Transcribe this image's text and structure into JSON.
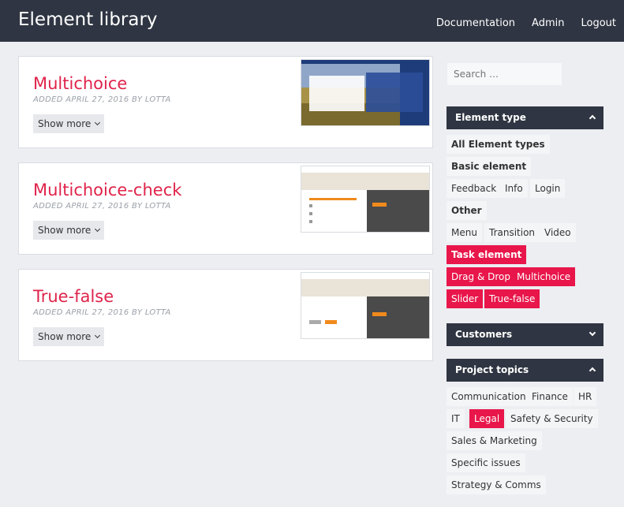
{
  "header": {
    "title": "Element library",
    "nav": [
      "Documentation",
      "Admin",
      "Logout"
    ]
  },
  "cards": [
    {
      "title": "Multichoice",
      "meta": "ADDED APRIL 27, 2016 BY LOTTA",
      "button": "Show more"
    },
    {
      "title": "Multichoice-check",
      "meta": "ADDED APRIL 27, 2016 BY LOTTA",
      "button": "Show more"
    },
    {
      "title": "True-false",
      "meta": "ADDED APRIL 27, 2016 BY LOTTA",
      "button": "Show more"
    }
  ],
  "sidebar": {
    "search_placeholder": "Search …",
    "element_type": {
      "title": "Element type",
      "tags": [
        "All Element types",
        "Basic element",
        "Feedback",
        "Info",
        "Login",
        "Other",
        "Menu",
        "Transition",
        "Video",
        "Task element",
        "Drag & Drop",
        "Multichoice",
        "Slider",
        "True-false"
      ]
    },
    "customers": {
      "title": "Customers"
    },
    "project_topics": {
      "title": "Project topics",
      "tags": [
        "Communication",
        "Finance",
        "HR",
        "IT",
        "Legal",
        "Safety & Security",
        "Sales & Marketing",
        "Specific issues",
        "Strategy & Comms"
      ]
    }
  },
  "colors": {
    "accent": "#e8164a",
    "header_bg": "#2f3542"
  }
}
